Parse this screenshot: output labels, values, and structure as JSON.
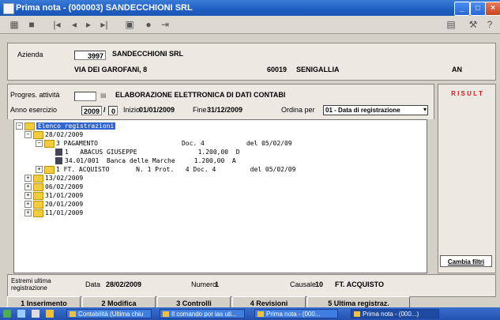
{
  "window": {
    "title": "Prima nota - (000003) SANDECCHIONI SRL"
  },
  "company": {
    "azienda_label": "Azienda",
    "code": "3997",
    "name": "SANDECCHIONI SRL",
    "address": "VIA DEI GAROFANI, 8",
    "cap": "60019",
    "city": "SENIGALLIA",
    "prov": "AN"
  },
  "activity": {
    "prog_label": "Progres. attività",
    "desc": "ELABORAZIONE ELETTRONICA DI DATI CONTABI",
    "anno_label": "Anno esercizio",
    "anno": "2009",
    "anno_suffix": "0",
    "inizio_label": "Inizio",
    "inizio": "01/01/2009",
    "fine_label": "Fine",
    "fine": "31/12/2009",
    "ordina_label": "Ordina per",
    "ordina_value": "01 - Data di registrazione",
    "side_button": "R I S U L T"
  },
  "tree": {
    "root": "Elenco registrazioni",
    "rows": [
      {
        "text": "28/02/2009"
      },
      {
        "text": "3 PAGAMENTO                      Doc. 4           del 05/02/09"
      },
      {
        "text": "1   ABACUS GIUSEPPE                1.200,00  D"
      },
      {
        "text": "34.01/001  Banca delle Marche     1.200,00  A"
      },
      {
        "text": "1 FT. ACQUISTO       N. 1 Prot.   4 Doc. 4         del 05/02/09"
      },
      {
        "text": "13/02/2009"
      },
      {
        "text": "06/02/2009"
      },
      {
        "text": "31/01/2009"
      },
      {
        "text": "20/01/2009"
      },
      {
        "text": "11/01/2009"
      }
    ]
  },
  "right_panel": {
    "button": "Cambia filtri"
  },
  "last_registration": {
    "label": "Estremi ultima registrazione",
    "data_label": "Data",
    "data": "28/02/2009",
    "numero_label": "Numero",
    "numero": "1",
    "causale_label": "Causale",
    "causale_code": "10",
    "causale_desc": "FT. ACQUISTO"
  },
  "actions": [
    "1 Inserimento",
    "2 Modifica",
    "3 Controlli",
    "4 Revisioni",
    "5 Ultima registraz."
  ],
  "taskbar": {
    "items": [
      "Contabilità (Ultima chiu",
      "Il comando por ias uti...",
      "Prima nota - (000...",
      "Prima nota - (000...)"
    ]
  },
  "colors": {
    "titlebar": "#1f5fc4",
    "folder": "#f2cc3a",
    "taskbar": "#2451b0"
  }
}
